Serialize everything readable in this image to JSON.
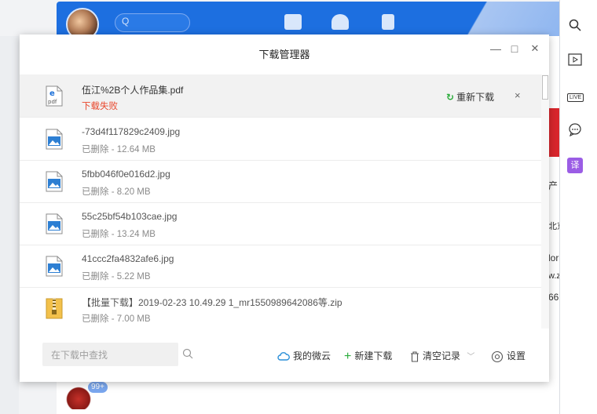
{
  "dialog": {
    "title": "下载管理器",
    "window_controls": {
      "minimize": "—",
      "maximize": "□",
      "close": "✕"
    }
  },
  "downloads": [
    {
      "name": "伍江%2B个人作品集.pdf",
      "status": "下载失败",
      "icon": "pdf-file-icon",
      "icon_label": "pdf",
      "failed": true
    },
    {
      "name": "-73d4f117829c2409.jpg",
      "status": "已删除 - 12.64 MB",
      "icon": "image-file-icon"
    },
    {
      "name": "5fbb046f0e016d2.jpg",
      "status": "已删除 - 8.20 MB",
      "icon": "image-file-icon"
    },
    {
      "name": "55c25bf54b103cae.jpg",
      "status": "已删除 - 13.24 MB",
      "icon": "image-file-icon"
    },
    {
      "name": "41ccc2fa4832afe6.jpg",
      "status": "已删除 - 5.22 MB",
      "icon": "image-file-icon"
    },
    {
      "name": "【批量下载】2019-02-23 10.49.29 1_mr1550989642086等.zip",
      "status": "已删除 - 7.00 MB",
      "icon": "zip-file-icon"
    }
  ],
  "row_actions": {
    "redownload": "重新下载",
    "remove": "×"
  },
  "footer": {
    "search_placeholder": "在下载中查找",
    "weiyun": "我的微云",
    "new_download": "新建下载",
    "clear_records": "清空记录",
    "settings": "设置"
  },
  "background": {
    "search_glyph": "Q",
    "badge": "99+",
    "fragments": [
      "产",
      "北京",
      "lor",
      "w.z",
      "66"
    ],
    "right_panel_icons": [
      "search-icon",
      "video-icon",
      "live-icon",
      "chat-icon",
      "translate-icon"
    ],
    "live_label": "LIVE",
    "translate_label": "译"
  },
  "colors": {
    "accent_blue": "#1d6fe0",
    "error_red": "#e9462b",
    "success_green": "#2bac3b",
    "translate_purple": "#9b5de5"
  }
}
